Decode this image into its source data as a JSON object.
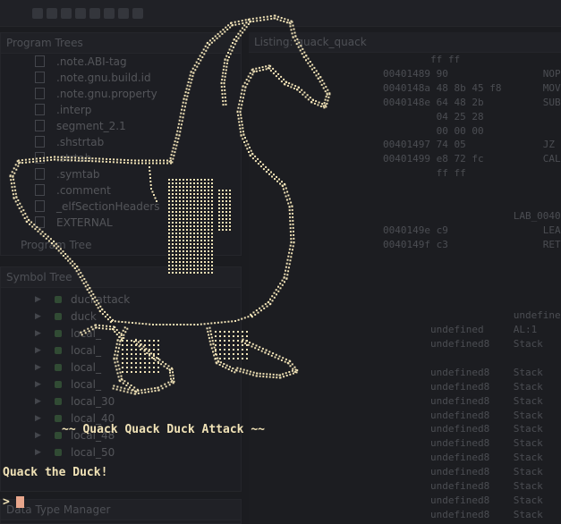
{
  "ide": {
    "program_trees": {
      "title": "Program Trees",
      "items": [
        ".note.ABI-tag",
        ".note.gnu.build.id",
        ".note.gnu.property",
        ".interp",
        "segment_2.1",
        ".shstrtab",
        ".strtab",
        ".symtab",
        ".comment",
        "_elfSectionHeaders",
        "EXTERNAL"
      ],
      "tab_label": "Program Tree"
    },
    "symbol_tree": {
      "title": "Symbol Tree",
      "items": [
        "duckattack",
        "duck",
        "local_",
        "local_",
        "local_",
        "local_",
        "local_30",
        "local_40",
        "local_48",
        "local_50"
      ]
    },
    "data_type_manager": {
      "title": "Data Type Manager"
    },
    "listing": {
      "title": "Listing: quack_quack",
      "rows": [
        "        ff ff",
        "00401489 90                NOP",
        "0040148a 48 8b 45 f8       MOV",
        "0040148e 64 48 2b          SUB",
        "         04 25 28",
        "         00 00 00",
        "00401497 74 05             JZ",
        "00401499 e8 72 fc          CALL",
        "         ff ff",
        "",
        "",
        "                      LAB_0040",
        "0040149e c9                LEAV",
        "0040149f c3                RET",
        "",
        "",
        "",
        "",
        "                      undefined",
        "        undefined     AL:1",
        "        undefined8    Stack",
        "",
        "        undefined8    Stack",
        "        undefined8    Stack",
        "        undefined8    Stack",
        "        undefined8    Stack",
        "        undefined8    Stack",
        "        undefined8    Stack",
        "        undefined8    Stack",
        "        undefined8    Stack",
        "        undefined8    Stack",
        "        undefined8    Stack",
        "        undefined8    Stack"
      ]
    }
  },
  "terminal": {
    "banner": "~~ Quack Quack Duck Attack ~~",
    "message": "Quack the Duck!",
    "prompt": ">",
    "art_color": "#f0e2b6",
    "cursor_color": "#e8a68c"
  }
}
